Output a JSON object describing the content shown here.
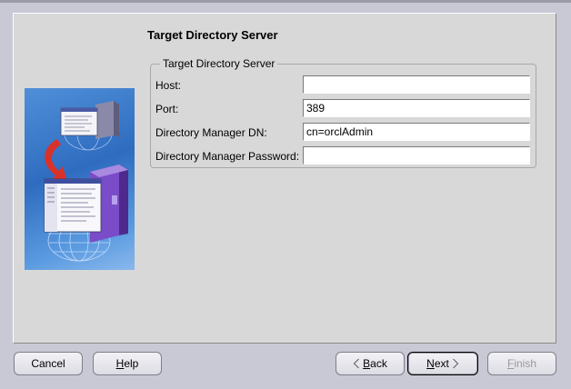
{
  "page": {
    "title": "Target Directory Server"
  },
  "group": {
    "legend": "Target Directory Server",
    "fields": [
      {
        "label": "Host:",
        "value": ""
      },
      {
        "label": "Port:",
        "value": "389"
      },
      {
        "label": "Directory Manager DN:",
        "value": "cn=orclAdmin"
      },
      {
        "label": "Directory Manager Password:",
        "value": ""
      }
    ]
  },
  "buttons": {
    "cancel": "Cancel",
    "help_mnemonic": "H",
    "help_rest": "elp",
    "back_mnemonic": "B",
    "back_rest": "ack",
    "next_mnemonic": "N",
    "next_rest": "ext",
    "finish_mnemonic": "F",
    "finish_rest": "inish"
  },
  "icons": {
    "back": "chevron-left-icon",
    "next": "chevron-right-icon"
  },
  "colors": {
    "background": "#c9c9d6",
    "panel": "#d8d8d8",
    "image_blue": "#2f6cc0",
    "arrow_red": "#d8332a",
    "server_purple": "#7a4cc8"
  }
}
